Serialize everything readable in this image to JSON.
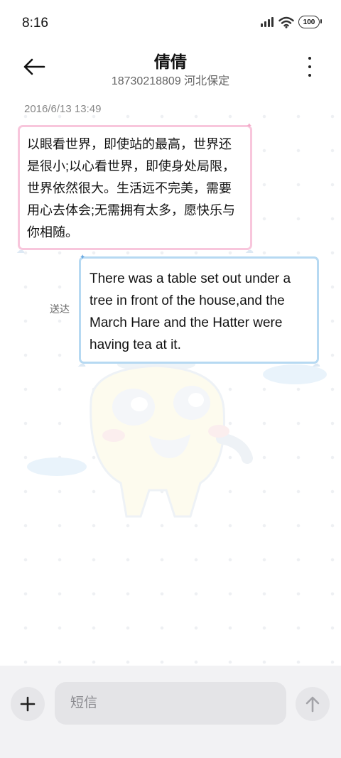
{
  "status_bar": {
    "time": "8:16",
    "battery": "100"
  },
  "header": {
    "contact_name": "倩倩",
    "contact_subtitle": "18730218809 河北保定"
  },
  "conversation": {
    "timestamp": "2016/6/13 13:49",
    "incoming_message": "以眼看世界，即使站的最高，世界还是很小;以心看世界，即使身处局限，世界依然很大。生活远不完美，需要用心去体会;无需拥有太多，愿快乐与你相随。",
    "outgoing_message": "There was a table set out under a tree in front of the house,and the March Hare and the Hatter were having tea at it.",
    "outgoing_status": "送达"
  },
  "composer": {
    "placeholder": "短信"
  },
  "colors": {
    "incoming_border": "#f8c6dc",
    "outgoing_border": "#b6d9f2",
    "composer_bg": "#f2f2f4"
  }
}
